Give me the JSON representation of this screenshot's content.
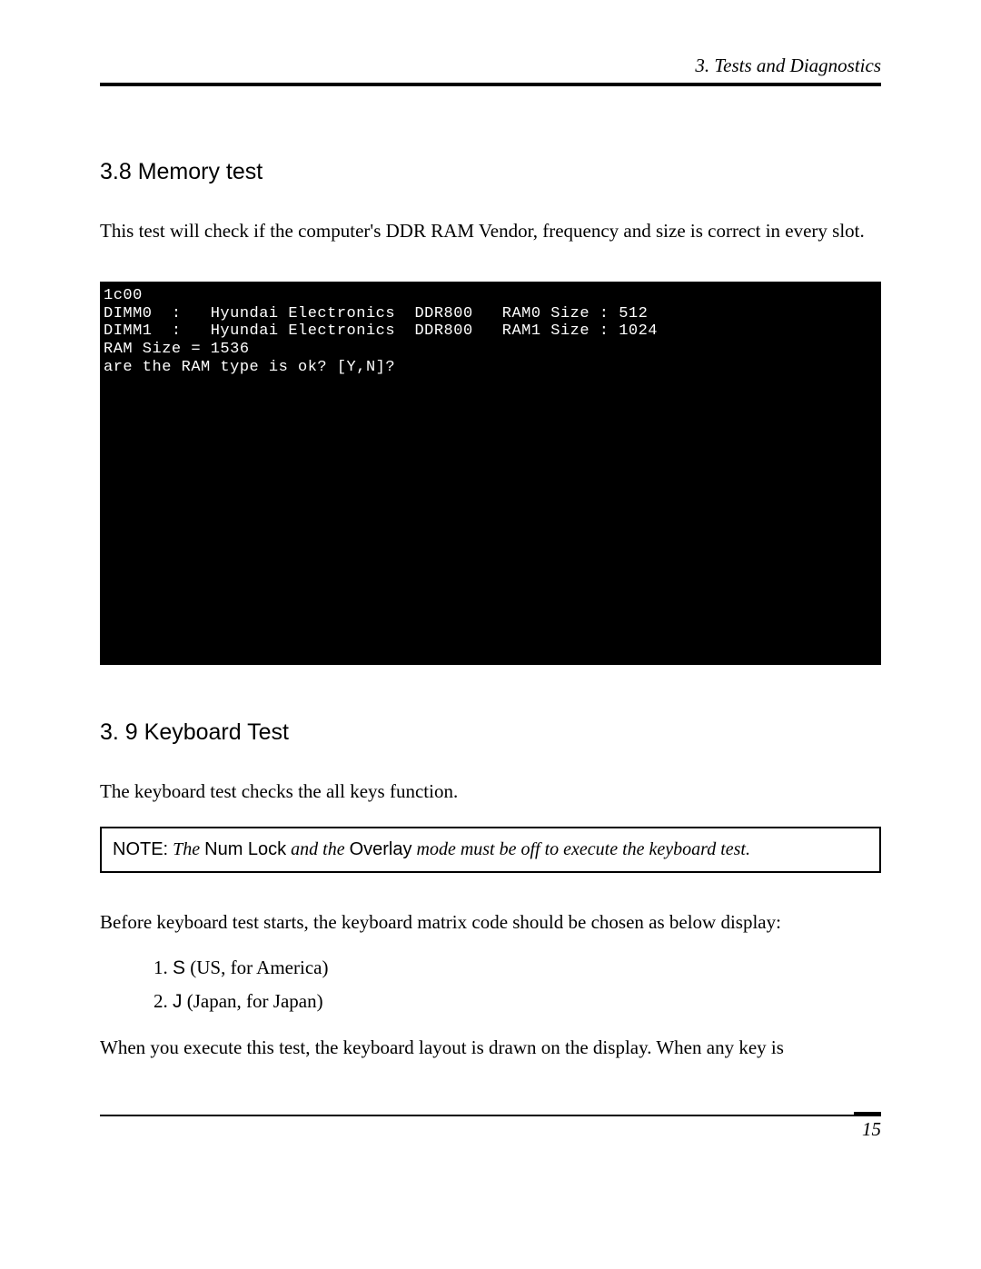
{
  "header": {
    "running": "3.  Tests and Diagnostics"
  },
  "section_mem": {
    "heading": "3.8  Memory test",
    "intro": "This test will check if the computer's DDR RAM Vendor, frequency and size is correct in every slot."
  },
  "terminal": {
    "lines": "1c00\nDIMM0  :   Hyundai Electronics  DDR800   RAM0 Size : 512\nDIMM1  :   Hyundai Electronics  DDR800   RAM1 Size : 1024\nRAM Size = 1536\nare the RAM type is ok? [Y,N]?"
  },
  "section_kb": {
    "heading": "3. 9 Keyboard Test",
    "intro": "The keyboard test checks the all keys function."
  },
  "note": {
    "label": "NOTE:",
    "t1": "The ",
    "k1": "Num Lock",
    "t2": " and the ",
    "k2": "Overlay",
    "t3": " mode must be off to execute the keyboard test."
  },
  "kb_body": {
    "before": "Before keyboard test starts, the keyboard matrix code should be chosen as below display:",
    "opt1_key": "S",
    "opt1_rest": " (US, for America)",
    "opt2_key": "J",
    "opt2_rest": " (Japan, for Japan)",
    "after": "When you execute this test, the keyboard layout is drawn on the display. When any key is"
  },
  "footer": {
    "page": "15"
  }
}
